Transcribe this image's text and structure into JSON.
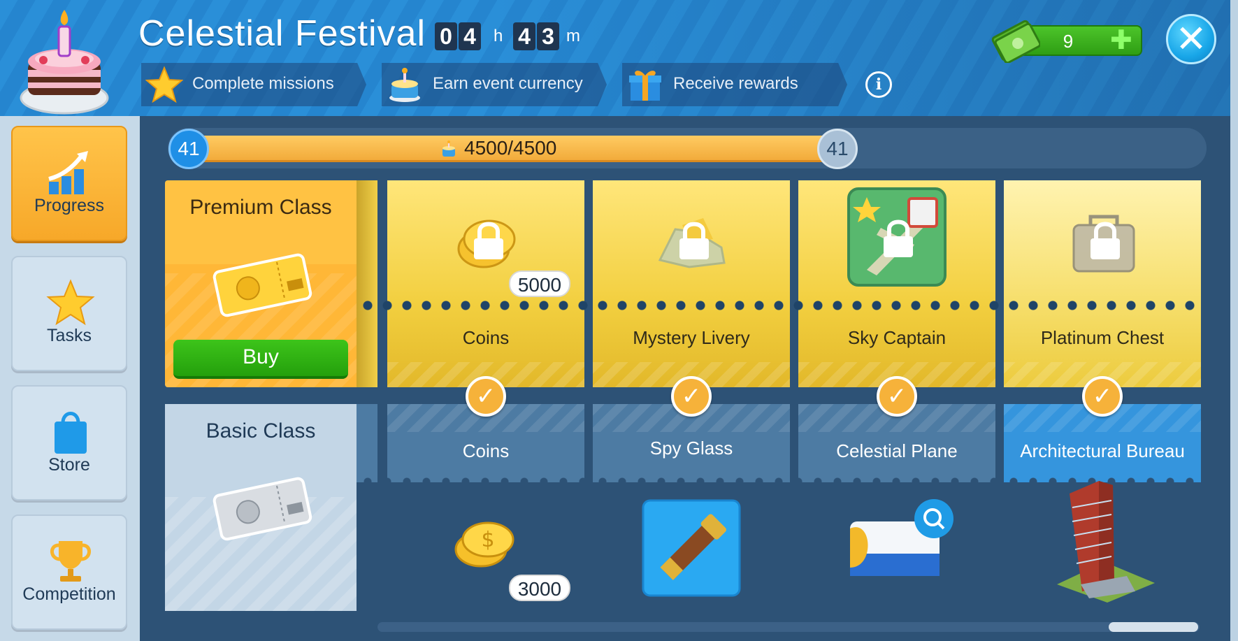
{
  "header": {
    "title": "Celestial Festival",
    "timer": {
      "h1": "0",
      "h2": "4",
      "h_unit": "h",
      "m1": "4",
      "m2": "3",
      "m_unit": "m"
    },
    "steps": [
      {
        "label": "Complete missions",
        "icon": "star-icon"
      },
      {
        "label": "Earn event currency",
        "icon": "cake-icon"
      },
      {
        "label": "Receive rewards",
        "icon": "gift-icon"
      }
    ],
    "info": "i",
    "currency": {
      "value": "9",
      "plus": "✚",
      "icon": "cash-icon"
    },
    "close": "✕"
  },
  "sidebar": {
    "items": [
      {
        "label": "Progress",
        "icon": "progress-chart-icon",
        "active": true
      },
      {
        "label": "Tasks",
        "icon": "star-icon",
        "active": false
      },
      {
        "label": "Store",
        "icon": "shopping-bag-icon",
        "active": false
      },
      {
        "label": "Competition",
        "icon": "trophy-icon",
        "active": false
      }
    ]
  },
  "progress": {
    "level_left": "41",
    "level_right": "41",
    "text": "4500/4500",
    "fraction": 1.0
  },
  "premium": {
    "title": "Premium Class",
    "buy": "Buy",
    "rewards": [
      {
        "name": "Coins",
        "amount": "5000",
        "icon": "coins-icon",
        "locked": true
      },
      {
        "name": "Mystery Livery",
        "icon": "mystery-livery-icon",
        "locked": true
      },
      {
        "name": "Sky Captain",
        "icon": "sky-captain-icon",
        "locked": true
      },
      {
        "name": "Platinum Chest",
        "icon": "platinum-chest-icon",
        "locked": true
      }
    ]
  },
  "basic": {
    "title": "Basic Class",
    "rewards": [
      {
        "name": "Coins",
        "amount": "3000",
        "icon": "coins-icon"
      },
      {
        "name": "Spy Glass",
        "icon": "spyglass-icon"
      },
      {
        "name": "Celestial Plane",
        "icon": "plane-livery-icon"
      },
      {
        "name": "Architectural Bureau",
        "icon": "building-icon"
      }
    ]
  },
  "colors": {
    "accent": "#f7a829",
    "green": "#2fa814",
    "blue": "#2585cf",
    "check": "#f6b23a"
  }
}
